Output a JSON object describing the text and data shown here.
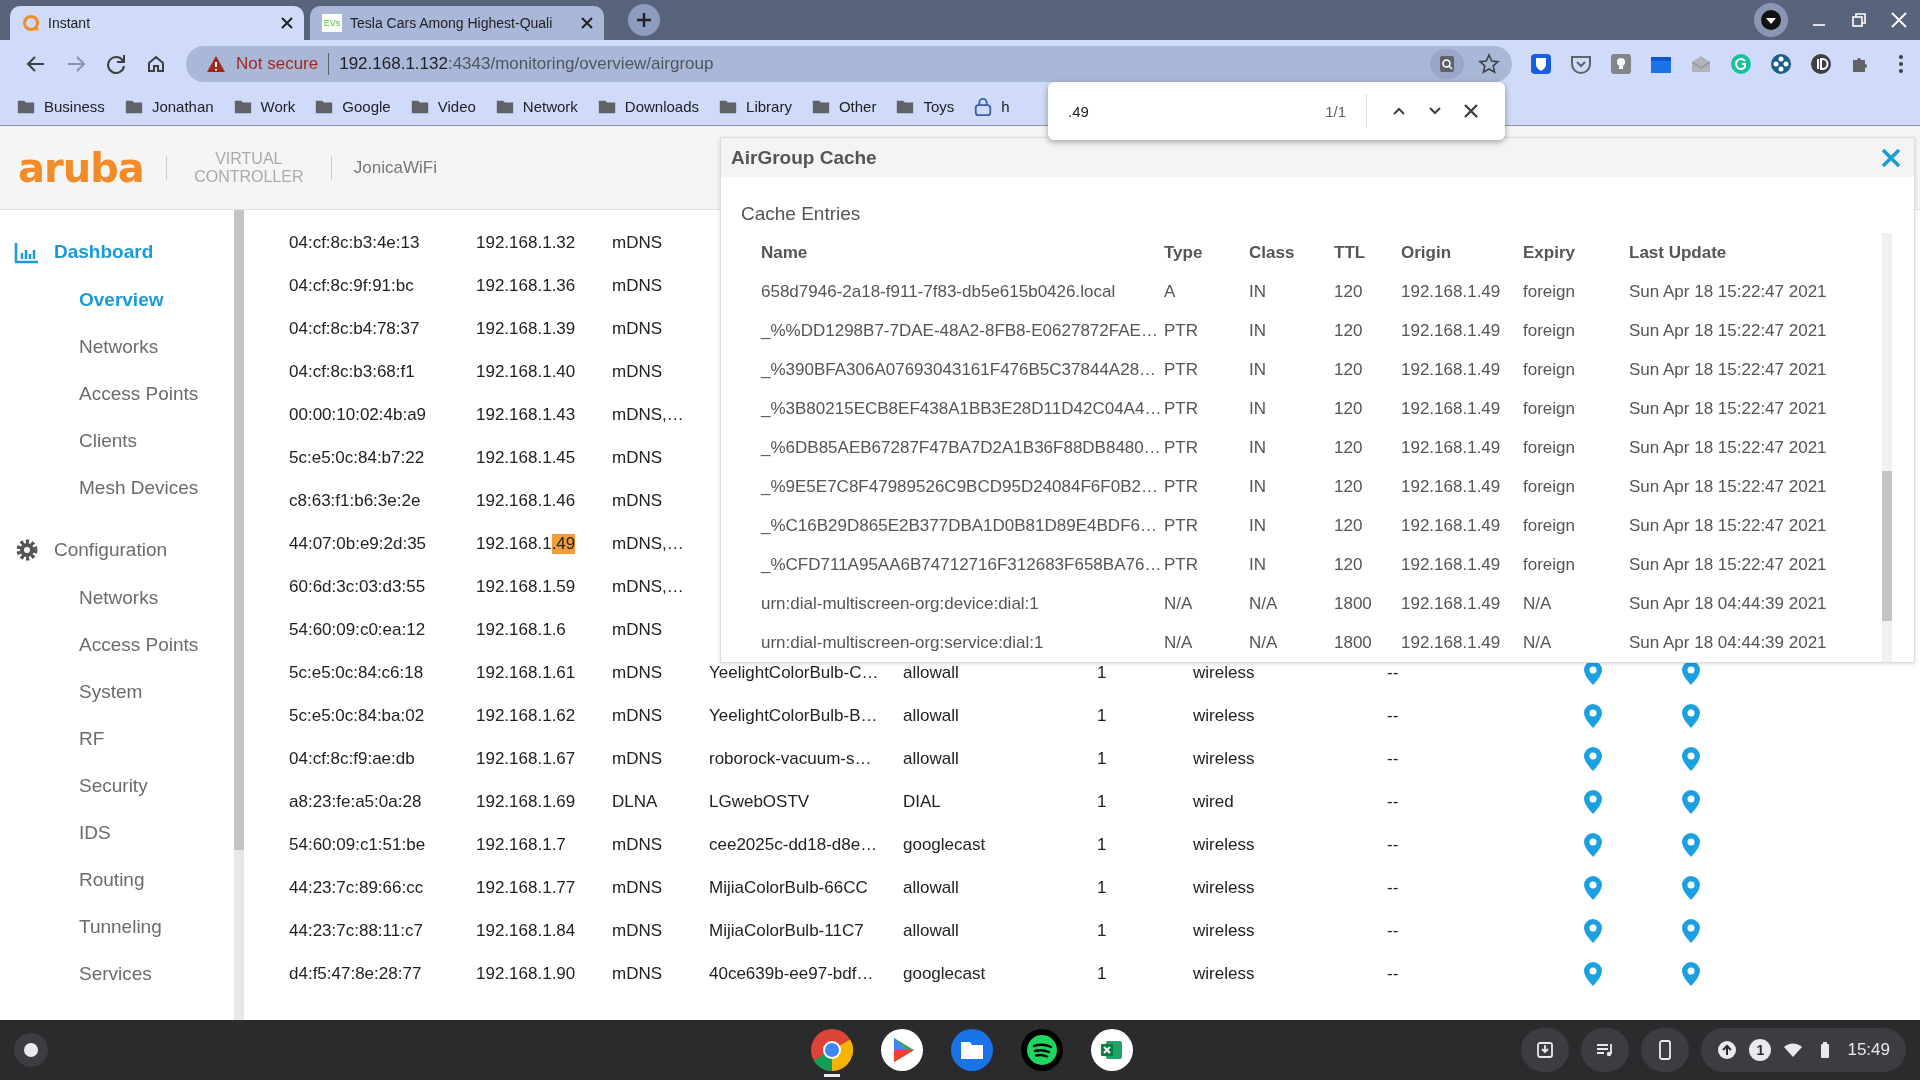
{
  "browser": {
    "tabs": [
      {
        "title": "Instant",
        "selected": true,
        "kind": "ring"
      },
      {
        "title": "Tesla Cars Among Highest-Quali",
        "selected": false,
        "kind": "text",
        "favicon_text": "EVs"
      }
    ],
    "security_label": "Not secure",
    "url_host": "192.168.1.132",
    "url_path": ":4343/monitoring/overview/airgroup",
    "bookmarks": [
      {
        "label": "Business",
        "kind": "folder"
      },
      {
        "label": "Jonathan",
        "kind": "folder"
      },
      {
        "label": "Work",
        "kind": "folder"
      },
      {
        "label": "Google",
        "kind": "folder"
      },
      {
        "label": "Video",
        "kind": "folder"
      },
      {
        "label": "Network",
        "kind": "folder"
      },
      {
        "label": "Downloads",
        "kind": "folder"
      },
      {
        "label": "Library",
        "kind": "folder"
      },
      {
        "label": "Other",
        "kind": "folder"
      },
      {
        "label": "Toys",
        "kind": "folder"
      },
      {
        "label": "h",
        "kind": "lock"
      }
    ],
    "find": {
      "value": ".49",
      "count": "1/1"
    }
  },
  "app": {
    "brand": "aruba",
    "product": "VIRTUAL CONTROLLER",
    "network": "JonicaWiFi"
  },
  "sidebar": [
    {
      "label": "Dashboard",
      "kind": "chart",
      "selected": true,
      "items": [
        {
          "label": "Overview",
          "selected": true
        },
        {
          "label": "Networks",
          "selected": false
        },
        {
          "label": "Access Points",
          "selected": false
        },
        {
          "label": "Clients",
          "selected": false
        },
        {
          "label": "Mesh Devices",
          "selected": false
        }
      ]
    },
    {
      "label": "Configuration",
      "kind": "gear",
      "selected": false,
      "items": [
        {
          "label": "Networks",
          "selected": false
        },
        {
          "label": "Access Points",
          "selected": false
        },
        {
          "label": "System",
          "selected": false
        },
        {
          "label": "RF",
          "selected": false
        },
        {
          "label": "Security",
          "selected": false
        },
        {
          "label": "IDS",
          "selected": false
        },
        {
          "label": "Routing",
          "selected": false
        },
        {
          "label": "Tunneling",
          "selected": false
        },
        {
          "label": "Services",
          "selected": false
        }
      ]
    }
  ],
  "devices": [
    {
      "mac": "04:cf:8c:b3:4e:13",
      "ip": "192.168.1.32",
      "type": "mDNS"
    },
    {
      "mac": "04:cf:8c:9f:91:bc",
      "ip": "192.168.1.36",
      "type": "mDNS"
    },
    {
      "mac": "04:cf:8c:b4:78:37",
      "ip": "192.168.1.39",
      "type": "mDNS"
    },
    {
      "mac": "04:cf:8c:b3:68:f1",
      "ip": "192.168.1.40",
      "type": "mDNS"
    },
    {
      "mac": "00:00:10:02:4b:a9",
      "ip": "192.168.1.43",
      "type": "mDNS,…"
    },
    {
      "mac": "5c:e5:0c:84:b7:22",
      "ip": "192.168.1.45",
      "type": "mDNS"
    },
    {
      "mac": "c8:63:f1:b6:3e:2e",
      "ip": "192.168.1.46",
      "type": "mDNS"
    },
    {
      "mac": "44:07:0b:e9:2d:35",
      "ip": "192.168.1",
      "ip_found": ".49",
      "type": "mDNS,…"
    },
    {
      "mac": "60:6d:3c:03:d3:55",
      "ip": "192.168.1.59",
      "type": "mDNS,…"
    },
    {
      "mac": "54:60:09:c0:ea:12",
      "ip": "192.168.1.6",
      "type": "mDNS"
    },
    {
      "mac": "5c:e5:0c:84:c6:18",
      "ip": "192.168.1.61",
      "type": "mDNS",
      "name": "YeelightColorBulb-C…",
      "service": "allowall",
      "count": "1",
      "connection": "wireless",
      "column_8": "--"
    },
    {
      "mac": "5c:e5:0c:84:ba:02",
      "ip": "192.168.1.62",
      "type": "mDNS",
      "name": "YeelightColorBulb-B…",
      "service": "allowall",
      "count": "1",
      "connection": "wireless",
      "column_8": "--"
    },
    {
      "mac": "04:cf:8c:f9:ae:db",
      "ip": "192.168.1.67",
      "type": "mDNS",
      "name": "roborock-vacuum-s…",
      "service": "allowall",
      "count": "1",
      "connection": "wireless",
      "column_8": "--"
    },
    {
      "mac": "a8:23:fe:a5:0a:28",
      "ip": "192.168.1.69",
      "type": "DLNA",
      "name": "LGwebOSTV",
      "service": "DIAL",
      "count": "1",
      "connection": "wired",
      "column_8": "--"
    },
    {
      "mac": "54:60:09:c1:51:be",
      "ip": "192.168.1.7",
      "type": "mDNS",
      "name": "cee2025c-dd18-d8e…",
      "service": "googlecast",
      "count": "1",
      "connection": "wireless",
      "column_8": "--"
    },
    {
      "mac": "44:23:7c:89:66:cc",
      "ip": "192.168.1.77",
      "type": "mDNS",
      "name": "MijiaColorBulb-66CC",
      "service": "allowall",
      "count": "1",
      "connection": "wireless",
      "column_8": "--"
    },
    {
      "mac": "44:23:7c:88:11:c7",
      "ip": "192.168.1.84",
      "type": "mDNS",
      "name": "MijiaColorBulb-11C7",
      "service": "allowall",
      "count": "1",
      "connection": "wireless",
      "column_8": "--"
    },
    {
      "mac": "d4:f5:47:8e:28:77",
      "ip": "192.168.1.90",
      "type": "mDNS",
      "name": "40ce639b-ee97-bdf…",
      "service": "googlecast",
      "count": "1",
      "connection": "wireless",
      "column_8": "--"
    }
  ],
  "cache": {
    "title": "AirGroup Cache",
    "section": "Cache Entries",
    "columns": [
      "Name",
      "Type",
      "Class",
      "TTL",
      "Origin",
      "Expiry",
      "Last Update"
    ],
    "rows": [
      [
        "658d7946-2a18-f911-7f83-db5e615b0426.local",
        "A",
        "IN",
        "120",
        "192.168.1.49",
        "foreign",
        "Sun Apr 18 15:22:47 2021"
      ],
      [
        "_%%DD1298B7-7DAE-48A2-8FB8-E0627872FAE…",
        "PTR",
        "IN",
        "120",
        "192.168.1.49",
        "foreign",
        "Sun Apr 18 15:22:47 2021"
      ],
      [
        "_%390BFA306A07693043161F476B5C37844A28…",
        "PTR",
        "IN",
        "120",
        "192.168.1.49",
        "foreign",
        "Sun Apr 18 15:22:47 2021"
      ],
      [
        "_%3B80215ECB8EF438A1BB3E28D11D42C04A4…",
        "PTR",
        "IN",
        "120",
        "192.168.1.49",
        "foreign",
        "Sun Apr 18 15:22:47 2021"
      ],
      [
        "_%6DB85AEB67287F47BA7D2A1B36F88DB8480…",
        "PTR",
        "IN",
        "120",
        "192.168.1.49",
        "foreign",
        "Sun Apr 18 15:22:47 2021"
      ],
      [
        "_%9E5E7C8F47989526C9BCD95D24084F6F0B2…",
        "PTR",
        "IN",
        "120",
        "192.168.1.49",
        "foreign",
        "Sun Apr 18 15:22:47 2021"
      ],
      [
        "_%C16B29D865E2B377DBA1D0B81D89E4BDF6…",
        "PTR",
        "IN",
        "120",
        "192.168.1.49",
        "foreign",
        "Sun Apr 18 15:22:47 2021"
      ],
      [
        "_%CFD711A95AA6B74712716F312683F658BA76…",
        "PTR",
        "IN",
        "120",
        "192.168.1.49",
        "foreign",
        "Sun Apr 18 15:22:47 2021"
      ],
      [
        "urn:dial-multiscreen-org:device:dial:1",
        "N/A",
        "N/A",
        "1800",
        "192.168.1.49",
        "N/A",
        "Sun Apr 18 04:44:39 2021"
      ],
      [
        "urn:dial-multiscreen-org:service:dial:1",
        "N/A",
        "N/A",
        "1800",
        "192.168.1.49",
        "N/A",
        "Sun Apr 18 04:44:39 2021"
      ]
    ]
  },
  "taskbar": {
    "apps": [
      {
        "kind": "chrome",
        "running": true
      },
      {
        "kind": "play",
        "running": false
      },
      {
        "kind": "files",
        "running": false
      },
      {
        "kind": "spotify",
        "running": false
      },
      {
        "kind": "excel",
        "running": false
      }
    ],
    "notifications": "1",
    "time": "15:49"
  }
}
